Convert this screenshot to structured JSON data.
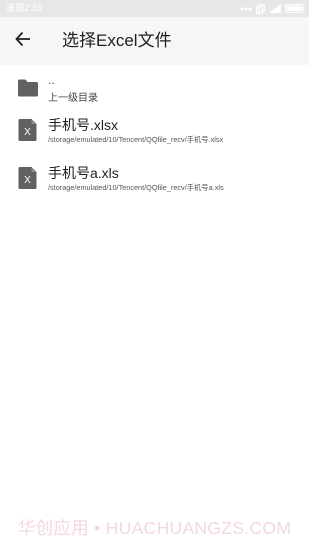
{
  "status_bar": {
    "time": "滚疆2:59",
    "icons": [
      "dots-icon",
      "screen-icon",
      "signal-icon",
      "battery-icon"
    ]
  },
  "app_bar": {
    "back_icon": "arrow-left-icon",
    "title": "选择Excel文件"
  },
  "file_list": {
    "items": [
      {
        "type": "folder",
        "icon": "folder-icon",
        "name": "..",
        "subtitle": "上一级目录"
      },
      {
        "type": "excel",
        "icon": "excel-file-icon",
        "name": "手机号.xlsx",
        "subtitle": "/storage/emulated/10/Tencent/QQfile_recv/手机号.xlsx"
      },
      {
        "type": "excel",
        "icon": "excel-file-icon",
        "name": "手机号a.xls",
        "subtitle": "/storage/emulated/10/Tencent/QQfile_recv/手机号a.xls"
      }
    ]
  },
  "watermark": {
    "text": "华创应用 • HUACHUANGZS.COM"
  },
  "colors": {
    "status_bar_bg": "#e7e7e7",
    "app_bar_bg": "#f6f6f6",
    "icon_gray": "#616161",
    "title_text": "#1f1f1f",
    "watermark": "#f3d8dc"
  }
}
